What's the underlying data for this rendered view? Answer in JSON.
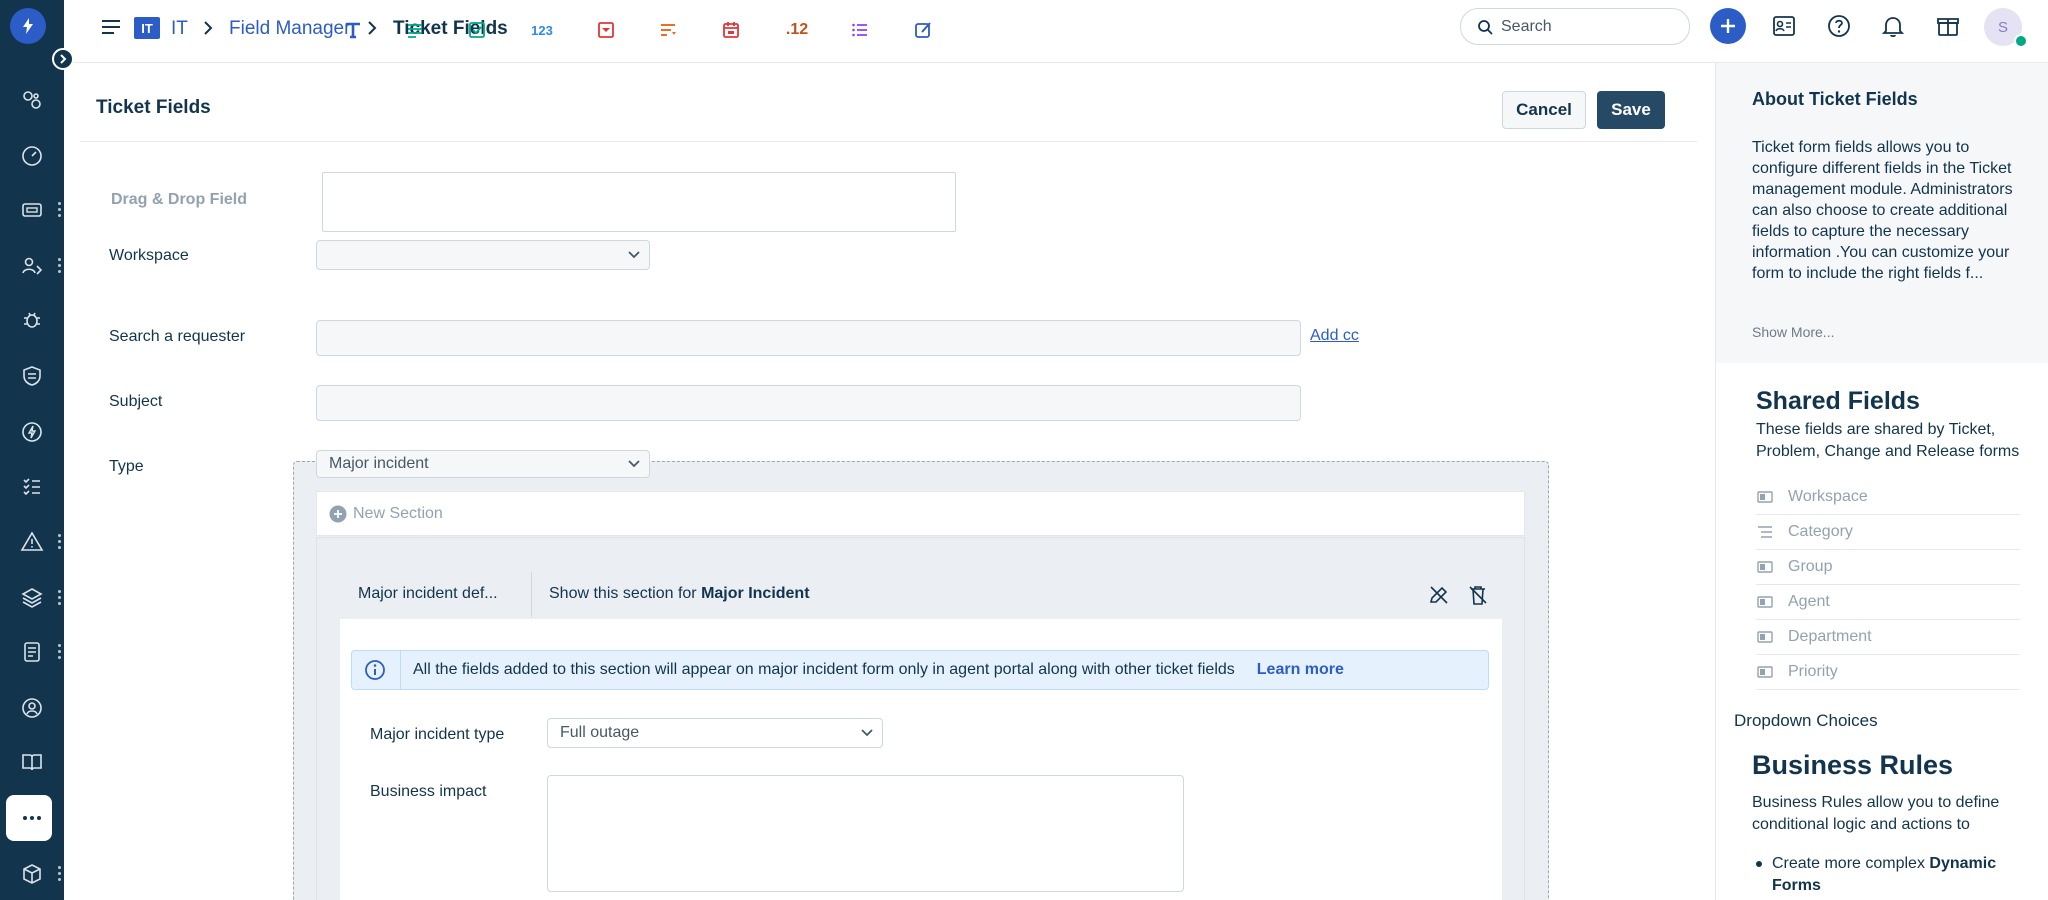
{
  "breadcrumb": {
    "workspace_badge": "IT",
    "workspace": "IT",
    "section": "Field Manager",
    "current": "Ticket Fields"
  },
  "search": {
    "placeholder": "Search"
  },
  "user": {
    "initial": "S"
  },
  "colors": {
    "primary": "#2c5cc5",
    "nav_bg": "#12344d",
    "save_bg": "#264966",
    "presence": "#00a886"
  },
  "page": {
    "title": "Ticket Fields",
    "cancel_label": "Cancel",
    "save_label": "Save"
  },
  "palette": {
    "label": "Drag & Drop Field",
    "number_label": "123",
    "decimal_label": ".12",
    "icons": [
      "text-field-icon",
      "paragraph-icon",
      "checkbox-icon",
      "number-icon",
      "dropdown-icon",
      "multiselect-icon",
      "date-icon",
      "decimal-icon",
      "dependent-field-icon",
      "custom-field-icon"
    ]
  },
  "form": {
    "workspace_label": "Workspace",
    "workspace_value": "",
    "requester_label": "Search a requester",
    "add_cc": "Add cc",
    "subject_label": "Subject",
    "type_label": "Type",
    "type_value": "Major incident"
  },
  "section": {
    "new_section": "New Section",
    "name": "Major incident def...",
    "condition_prefix": "Show this section for",
    "condition_value": "Major Incident",
    "info_text": "All the fields added to this section will appear on major incident form only in agent portal along with other ticket fields",
    "learn_more": "Learn more",
    "major_type_label": "Major incident type",
    "major_type_value": "Full outage",
    "business_impact_label": "Business impact"
  },
  "right_panel": {
    "about_title": "About Ticket Fields",
    "about_text": "Ticket form fields allows you to configure different fields in the Ticket management module. Administrators can also choose to create additional fields to capture the necessary information .You can customize your form to include the right fields f...",
    "show_more": "Show More...",
    "shared_title": "Shared Fields",
    "shared_desc": "These fields are shared by Ticket, Problem, Change and Release forms",
    "shared_fields": [
      {
        "label": "Workspace"
      },
      {
        "label": "Category"
      },
      {
        "label": "Group"
      },
      {
        "label": "Agent"
      },
      {
        "label": "Department"
      },
      {
        "label": "Priority"
      }
    ],
    "dropdown_choices": "Dropdown Choices",
    "br_title": "Business Rules",
    "br_desc": "Business Rules allow you to define conditional logic and actions to",
    "br_item_prefix": "Create more complex",
    "br_item_bold": "Dynamic Forms"
  }
}
